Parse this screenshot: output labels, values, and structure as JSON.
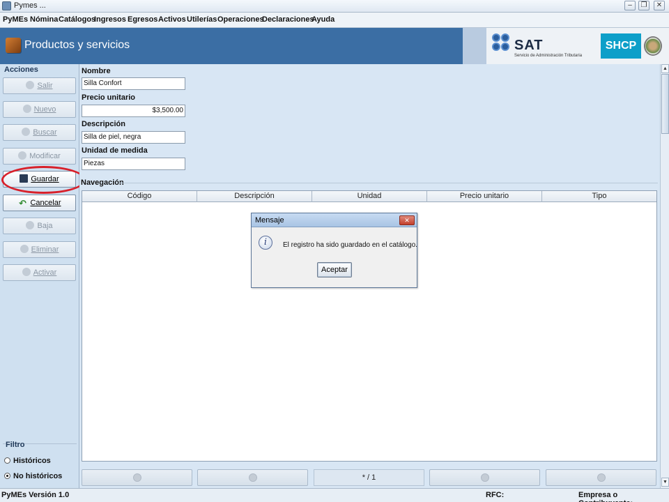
{
  "window": {
    "title": "Pymes ..."
  },
  "menu": [
    {
      "label": "PyMEs"
    },
    {
      "label": "Nómina"
    },
    {
      "label": "Catálogos"
    },
    {
      "label": "Ingresos"
    },
    {
      "label": "Egresos"
    },
    {
      "label": "Activos"
    },
    {
      "label": "Utilerías"
    },
    {
      "label": "Operaciones"
    },
    {
      "label": "Declaraciones"
    },
    {
      "label": "Ayuda"
    }
  ],
  "header": {
    "title": "Productos y servicios",
    "sat_text": "SAT",
    "sat_subtitle": "Servicio de Administración Tributaria",
    "shcp_text": "SHCP"
  },
  "actions": {
    "group_title": "Acciones",
    "buttons": [
      {
        "label": "Salir",
        "enabled": false
      },
      {
        "label": "Nuevo",
        "enabled": false
      },
      {
        "label": "Buscar",
        "enabled": false
      },
      {
        "label": "Modificar",
        "enabled": false
      },
      {
        "label": "Guardar",
        "enabled": true
      },
      {
        "label": "Cancelar",
        "enabled": true
      },
      {
        "label": "Baja",
        "enabled": false
      },
      {
        "label": "Eliminar",
        "enabled": false
      },
      {
        "label": "Activar",
        "enabled": false
      }
    ]
  },
  "filter": {
    "title": "Filtro",
    "options": [
      {
        "label": "Históricos",
        "selected": false
      },
      {
        "label": "No históricos",
        "selected": true
      }
    ]
  },
  "form": {
    "name_label": "Nombre",
    "name_value": "Silla Confort",
    "price_label": "Precio unitario",
    "price_value": "$3,500.00",
    "desc_label": "Descripción",
    "desc_value": "Silla de piel, negra",
    "unit_label": "Unidad de medida",
    "unit_value": "Piezas"
  },
  "navigation": {
    "title": "Navegación",
    "columns": [
      "Código",
      "Descripción",
      "Unidad",
      "Precio unitario",
      "Tipo"
    ],
    "pager_text": "* / 1"
  },
  "dialog": {
    "title": "Mensaje",
    "message": "El registro ha sido guardado en el catálogo.",
    "button": "Aceptar"
  },
  "status": {
    "version": "PyMEs Versión 1.0",
    "rfc_label": "RFC:",
    "company_label": "Empresa o Contribuyente:"
  },
  "colors": {
    "banner": "#3b6ea4",
    "highlight": "#d8202a",
    "shcp": "#0d9fc9"
  }
}
